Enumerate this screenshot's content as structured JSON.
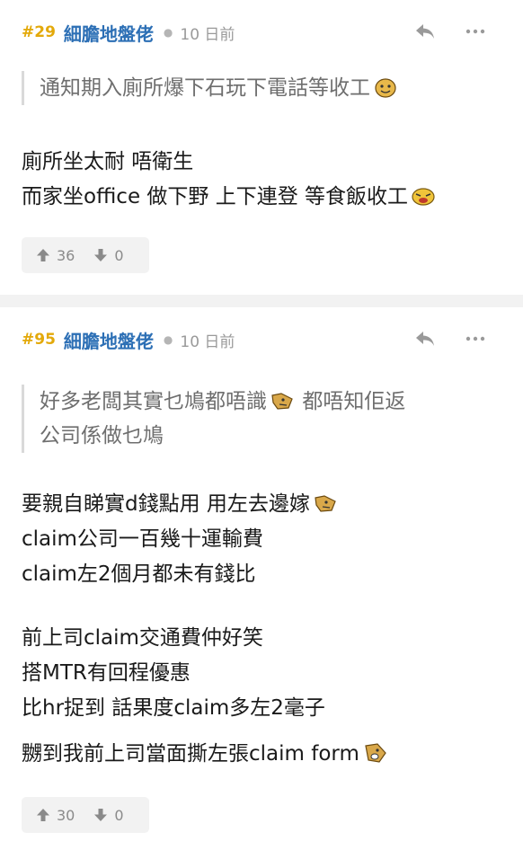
{
  "posts": [
    {
      "number": "#29",
      "username": "細膽地盤佬",
      "time": "10 日前",
      "quote": [
        "通知期入廁所爆下石玩下電話等收工"
      ],
      "paragraphs": [
        [
          "廁所坐太耐 唔衛生",
          "而家坐office 做下野 上下連登 等食飯收工"
        ]
      ],
      "upvotes": "36",
      "downvotes": "0"
    },
    {
      "number": "#95",
      "username": "細膽地盤佬",
      "time": "10 日前",
      "quote": [
        "好多老闆其實乜鳩都唔識",
        "都唔知佢返",
        "公司係做乜鳩"
      ],
      "paragraphs": [
        [
          "要親自睇實d錢點用 用左去邊嫁",
          "claim公司一百幾十運輸費",
          "claim左2個月都未有錢比"
        ],
        [
          "前上司claim交通費仲好笑",
          "搭MTR有回程優惠",
          "比hr捉到 話果度claim多左2毫子"
        ],
        [
          "嬲到我前上司當面撕左張claim form"
        ]
      ],
      "upvotes": "30",
      "downvotes": "0"
    }
  ],
  "icons": [
    "reply-icon",
    "more-icon",
    "upvote-arrow-icon",
    "downvote-arrow-icon",
    "emoji-icon"
  ],
  "colors": {
    "post_number": "#e3a90a",
    "username": "#2c6fb5",
    "quote_border": "#d9d9d9",
    "vote_bg": "#f2f2f2",
    "divider": "#f2f2f2"
  }
}
